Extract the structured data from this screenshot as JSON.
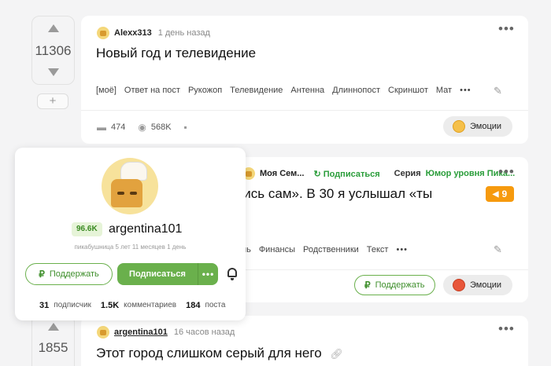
{
  "post1": {
    "rating": "11306",
    "author": "Alexx313",
    "time": "1 день назад",
    "title": "Новый год и телевидение",
    "tags": [
      "[моё]",
      "Ответ на пост",
      "Рукожоп",
      "Телевидение",
      "Антенна",
      "Длиннопост",
      "Скриншот",
      "Мат"
    ],
    "comments": "474",
    "views": "568K",
    "emotions_label": "Эмоции"
  },
  "post2": {
    "community": "Моя Сем...",
    "subscribed": "Подписаться",
    "series_label": "Серия",
    "series_name": "Юмор уровня Пика...",
    "title_fragment": "утись сам». В 30 я услышал «ты",
    "badge_count": "9",
    "tags_visible": [
      "нь",
      "Финансы",
      "Родственники",
      "Текст"
    ],
    "support_label": "Поддержать",
    "emotions_label": "Эмоции"
  },
  "post3": {
    "rating": "1855",
    "author": "argentina101",
    "time": "16 часов назад",
    "title": "Этот город слишком серый для него"
  },
  "profile_popup": {
    "rating": "96.6K",
    "name": "argentina101",
    "subtitle": "пикабушница 5 лет 11 месяцев 1 день",
    "support_label": "Поддержать",
    "subscribe_label": "Подписаться",
    "subscribers_count": "31",
    "subscribers_label": "подписчик",
    "comments_count": "1.5K",
    "comments_label": "комментариев",
    "posts_count": "184",
    "posts_label": "поста"
  },
  "colors": {
    "accent_green": "#6ab04c",
    "badge_orange": "#f69a0e",
    "background": "#f4f4f5"
  },
  "icons": [
    "arrow-up-icon",
    "arrow-down-icon",
    "plus-icon",
    "more-dots-icon",
    "pencil-icon",
    "comment-icon",
    "eye-icon",
    "save-icon",
    "ruble-icon",
    "bell-icon",
    "megaphone-icon",
    "link-icon"
  ]
}
